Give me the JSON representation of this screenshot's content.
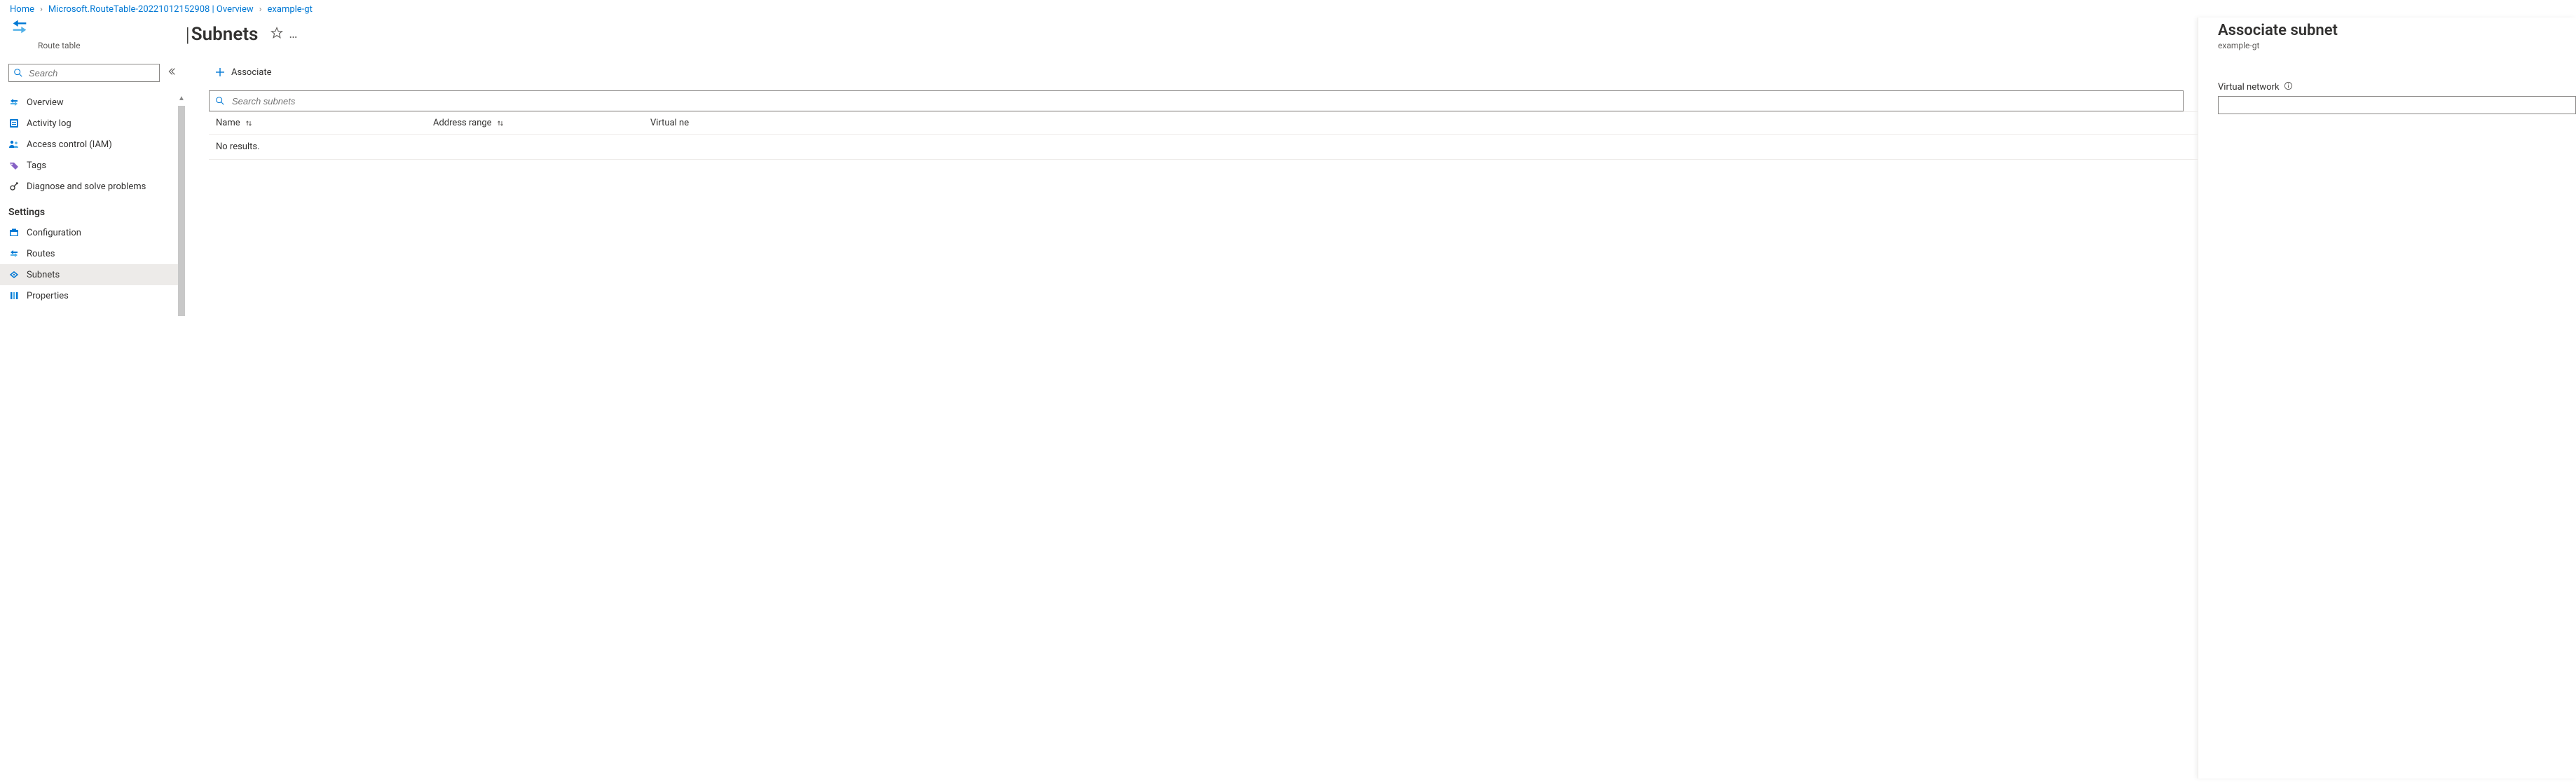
{
  "breadcrumb": {
    "home": "Home",
    "level1": "Microsoft.RouteTable-20221012152908 | Overview",
    "current": "example-gt"
  },
  "header": {
    "resource_type": "Route table",
    "page_title": "Subnets"
  },
  "sidebar": {
    "search_placeholder": "Search",
    "items": {
      "overview": "Overview",
      "activity": "Activity log",
      "iam": "Access control (IAM)",
      "tags": "Tags",
      "diagnose": "Diagnose and solve problems"
    },
    "section_settings": "Settings",
    "settings": {
      "config": "Configuration",
      "routes": "Routes",
      "subnets": "Subnets",
      "properties": "Properties"
    }
  },
  "toolbar": {
    "associate": "Associate"
  },
  "grid": {
    "search_placeholder": "Search subnets",
    "col_name": "Name",
    "col_addr": "Address range",
    "col_vnet": "Virtual ne",
    "empty": "No results."
  },
  "flyout": {
    "title": "Associate subnet",
    "subtitle": "example-gt",
    "field_vnet": "Virtual network",
    "field_vnet_value": ""
  }
}
